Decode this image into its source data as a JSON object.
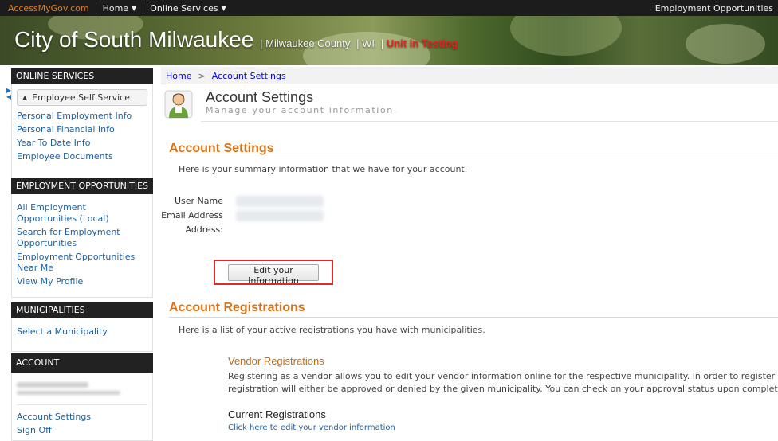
{
  "topbar": {
    "brand": "AccessMyGov.com",
    "home": "Home",
    "online_services": "Online Services",
    "right_link": "Employment Opportunities"
  },
  "banner": {
    "city": "City of South Milwaukee",
    "county": "Milwaukee County",
    "state": "WI",
    "testing": "Unit in Testing"
  },
  "sidebar": {
    "online_services": {
      "header": "ONLINE SERVICES",
      "group": "Employee Self Service",
      "items": [
        "Personal Employment Info",
        "Personal Financial Info",
        "Year To Date Info",
        "Employee Documents"
      ]
    },
    "employment": {
      "header": "EMPLOYMENT OPPORTUNITIES",
      "items": [
        "All Employment Opportunities (Local)",
        "Search for Employment Opportunities",
        "Employment Opportunities Near Me",
        "View My Profile"
      ]
    },
    "municipalities": {
      "header": "MUNICIPALITIES",
      "items": [
        "Select a Municipality"
      ]
    },
    "account": {
      "header": "ACCOUNT",
      "items": [
        "Account Settings",
        "Sign Off"
      ]
    }
  },
  "breadcrumb": {
    "home": "Home",
    "sep": ">",
    "current": "Account Settings"
  },
  "page": {
    "title": "Account Settings",
    "tagline": "Manage your account information."
  },
  "settings": {
    "title": "Account Settings",
    "desc": "Here is your summary information that we have for your account.",
    "labels": {
      "user": "User Name",
      "email": "Email Address",
      "address": "Address:"
    },
    "edit_button": "Edit your Information"
  },
  "registrations": {
    "title": "Account Registrations",
    "desc": "Here is a list of your active registrations you have with municipalities.",
    "vendor_title": "Vendor Registrations",
    "vendor_line1": "Registering as a vendor allows you to edit your vendor information online for the respective municipality. In order to register your a",
    "vendor_line2": "registration will either be approved or denied by the given municipality. You can check on your approval status upon completing yo",
    "current_title": "Current Registrations",
    "current_link": "Click here to edit your vendor information"
  },
  "colors": {
    "accent": "#d87318",
    "link": "#1e5f9e",
    "highlight": "#e02a2a"
  }
}
